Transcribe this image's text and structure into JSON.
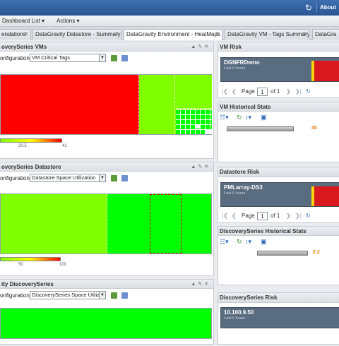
{
  "header": {
    "refresh_icon": "refresh-icon",
    "about": "About"
  },
  "menu": {
    "dashboard_list": "Dashboard List",
    "actions": "Actions"
  },
  "tabs": [
    {
      "label": "endations"
    },
    {
      "label": "DataGravity Datastore - Summary"
    },
    {
      "label": "DataGravity Environment - HeatMaps"
    },
    {
      "label": "DataGravity VM - Tags Summary"
    },
    {
      "label": "DataGra"
    }
  ],
  "panels": {
    "vms": {
      "title": "overySeries VMs",
      "cfg_label": "onfigurations:",
      "cfg_value": "VM Critical Tags",
      "scale_mid": "20.5",
      "scale_max": "41"
    },
    "datastore": {
      "title": "overySeries Datastore",
      "cfg_label": "onfigurations:",
      "cfg_value": "Datastore Space Utilization",
      "scale_mid": "50",
      "scale_max": "100"
    },
    "discovery": {
      "title": "ity DiscoverySeries",
      "cfg_label": "onfigurations:",
      "cfg_value": "DiscoverySeries Space Utilizatio"
    },
    "vm_risk": {
      "title": "VM Risk",
      "box_name": "DGNFRDemo",
      "box_sub": "Last 6 hours",
      "page_label": "Page",
      "page_value": "1",
      "of_label": "of 1"
    },
    "vm_hist": {
      "title": "VM Historical Stats",
      "value": "40"
    },
    "ds_risk": {
      "title": "Datastore Risk",
      "box_name": "PMLarray-DS3",
      "box_sub": "Last 6 hours",
      "page_label": "Page",
      "page_value": "1",
      "of_label": "of 1"
    },
    "ds_hist": {
      "title": "DiscoverySeries Historical Stats",
      "value": "2.2"
    },
    "disc_risk": {
      "title": "DiscoverySeries Risk",
      "box_name": "10.100.9.50",
      "box_sub": "Last 6 hours"
    }
  },
  "colors": {
    "red": "#ff0000",
    "green": "#00ff00",
    "lime": "#7fff00",
    "orange": "#f07a00"
  }
}
